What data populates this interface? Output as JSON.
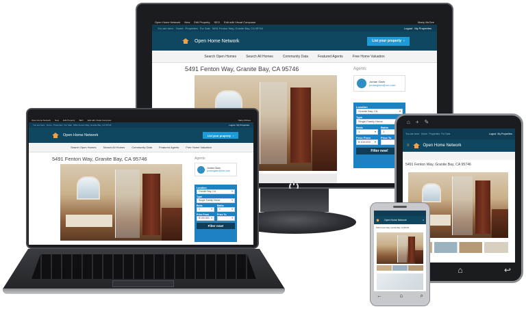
{
  "admin_bar": {
    "site": "Open Home Network",
    "new": "New",
    "edit_property": "Edit Property",
    "seo": "SEO",
    "visual_composer": "Edit with Visual Composer",
    "user": "Marty McGee"
  },
  "breadcrumb": {
    "you_are_here": "You are here:",
    "home": "Home",
    "properties": "Properties",
    "for_sale": "For Sale",
    "current": "5491 Fenton Way, Granite Bay, CA 95746",
    "logout": "Logout",
    "my_properties": "My Properties"
  },
  "header": {
    "brand": "Open Home Network",
    "list_button": "List your property"
  },
  "nav": {
    "items": [
      "Search Open Homes",
      "Search All Homes",
      "Community Data",
      "Featured Agents",
      "Free Home Valuation"
    ]
  },
  "property": {
    "title": "5491 Fenton Way, Granite Bay, CA 95746"
  },
  "agents": {
    "heading": "Agents",
    "name": "Jordan Glam",
    "email": "jordanglam@xxx.com"
  },
  "search": {
    "location_label": "Location",
    "location_value": "Granite Bay, CA",
    "type_label": "Type",
    "type_value": "Single Family Home",
    "beds_label": "Beds",
    "beds_value": "1",
    "baths_label": "Baths",
    "baths_value": "1",
    "price_from_label": "Price From",
    "price_from_value": "$ 100,000",
    "price_to_label": "Price To",
    "price_to_value": "",
    "filter_button": "Filter now!"
  },
  "colors": {
    "header": "#0f4660",
    "crumb": "#0e3c52",
    "accent": "#1c9bd8",
    "search_panel": "#1e82c2",
    "filter_button": "#0f3c57",
    "home_icon": "#f0a24a"
  }
}
